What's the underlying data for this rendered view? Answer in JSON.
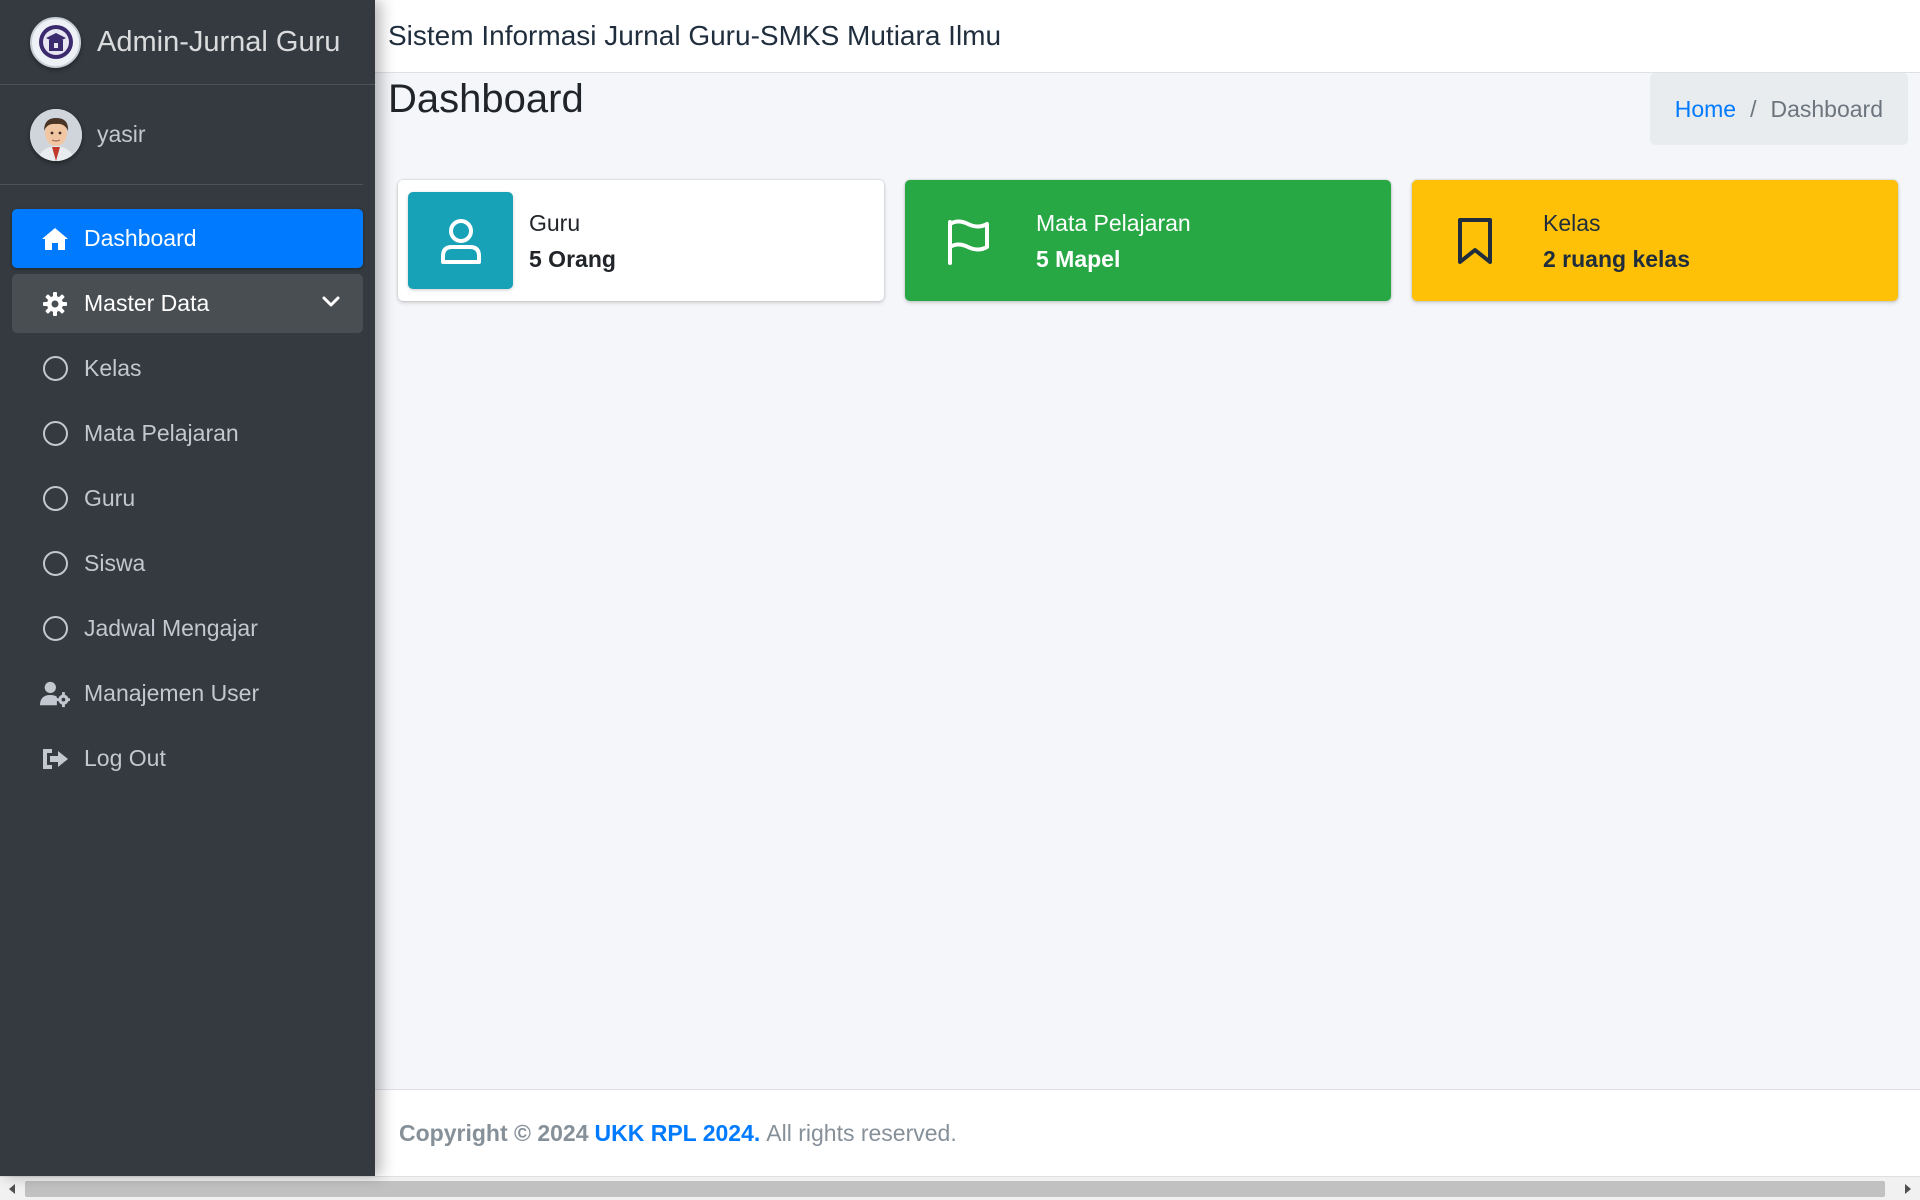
{
  "sidebar": {
    "brand": "Admin-Jurnal Guru",
    "user": "yasir",
    "items": [
      {
        "label": "Dashboard",
        "icon": "home-icon",
        "active": true
      },
      {
        "label": "Master Data",
        "icon": "gear-icon",
        "open": true
      },
      {
        "label": "Kelas",
        "icon": "circle-icon"
      },
      {
        "label": "Mata Pelajaran",
        "icon": "circle-icon"
      },
      {
        "label": "Guru",
        "icon": "circle-icon"
      },
      {
        "label": "Siswa",
        "icon": "circle-icon"
      },
      {
        "label": "Jadwal Mengajar",
        "icon": "circle-icon"
      },
      {
        "label": "Manajemen User",
        "icon": "user-gear-icon"
      },
      {
        "label": "Log Out",
        "icon": "logout-icon"
      }
    ]
  },
  "header": {
    "title": "Sistem Informasi Jurnal Guru-SMKS Mutiara Ilmu"
  },
  "page": {
    "title": "Dashboard",
    "breadcrumb": {
      "home": "Home",
      "separator": "/",
      "current": "Dashboard"
    }
  },
  "boxes": [
    {
      "label": "Guru",
      "value": "5 Orang",
      "icon": "user-icon",
      "color": "#17a2b8"
    },
    {
      "label": "Mata Pelajaran",
      "value": "5 Mapel",
      "icon": "flag-icon",
      "color": "#28a745"
    },
    {
      "label": "Kelas",
      "value": "2 ruang kelas",
      "icon": "bookmark-icon",
      "color": "#ffc107"
    }
  ],
  "footer": {
    "prefix": "Copyright © 2024",
    "brand": "UKK RPL 2024.",
    "suffix": "All rights reserved."
  },
  "colors": {
    "sidebar_bg": "#343a40",
    "primary": "#007bff",
    "success": "#28a745",
    "warning": "#ffc107",
    "info": "#17a2b8"
  }
}
